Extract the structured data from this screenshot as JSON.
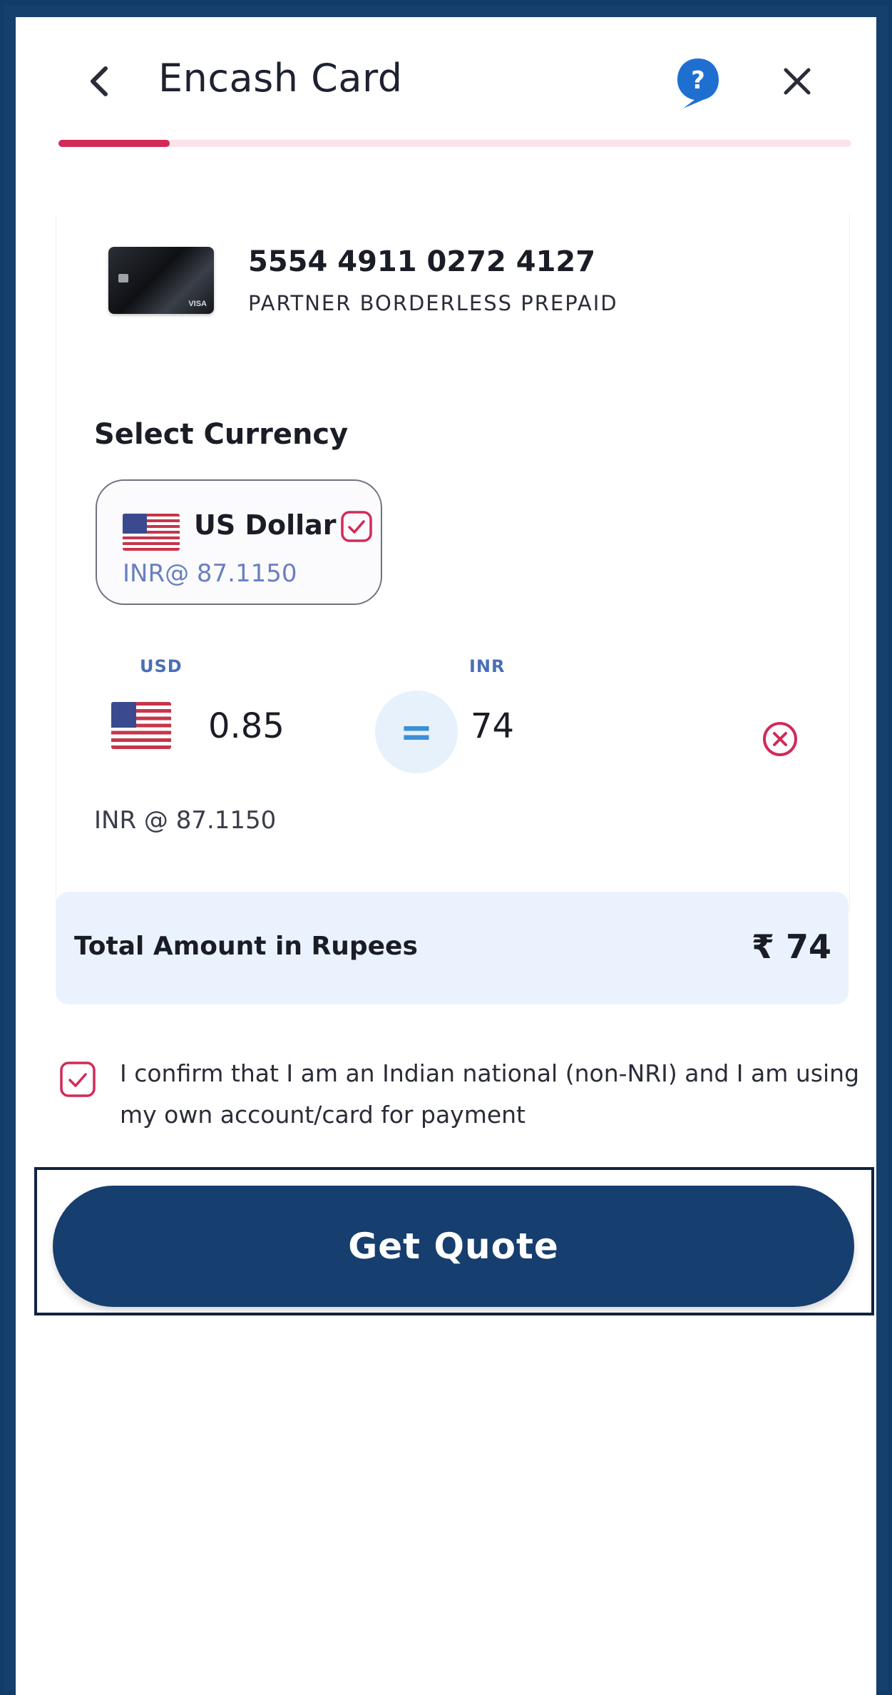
{
  "header": {
    "title": "Encash Card",
    "progress_fraction": 0.14
  },
  "card": {
    "number": "5554 4911 0272 4127",
    "name": "PARTNER BORDERLESS PREPAID",
    "brand_mark": "VISA"
  },
  "currency": {
    "section_title": "Select Currency",
    "selected": {
      "label": "US Dollar",
      "rate": "INR@ 87.1150",
      "checked": true
    }
  },
  "converter": {
    "from_code": "USD",
    "to_code": "INR",
    "from_amount": "0.85",
    "to_amount": "74",
    "equals": "=",
    "rate_note": "INR @ 87.1150"
  },
  "total": {
    "label": "Total Amount in Rupees",
    "value": "₹ 74"
  },
  "confirmation": {
    "text": "I confirm that I am an Indian national (non-NRI) and I am using my own account/card for payment",
    "checked": true
  },
  "actions": {
    "quote_label": "Get Quote"
  },
  "colors": {
    "primary": "#163e6e",
    "accent": "#d22a57",
    "highlight_bg": "#eaf3fd",
    "rate_text": "#6a7fc0"
  },
  "icons": {
    "back": "chevron-left-icon",
    "help": "help-icon",
    "close": "close-icon",
    "check": "checkbox-checked-icon",
    "clear": "clear-circle-icon",
    "flag": "us-flag-icon"
  }
}
